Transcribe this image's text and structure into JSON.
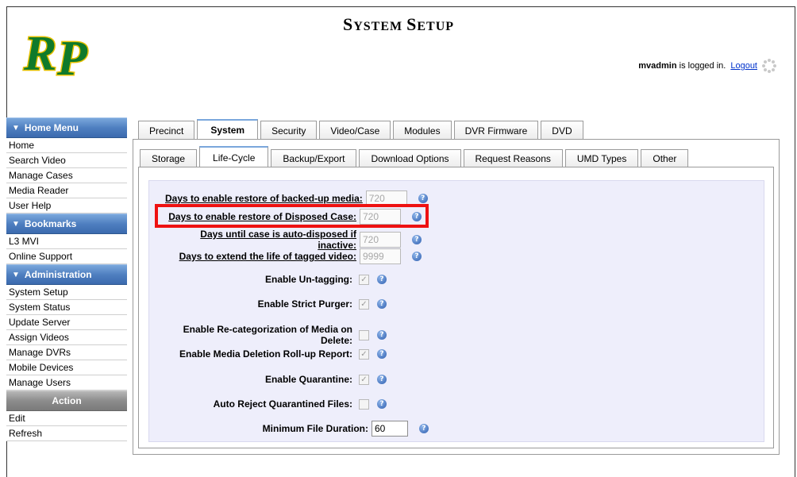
{
  "header": {
    "title_first_letter": "S",
    "title_rest_1": "YSTEM ",
    "title_second_letter": "S",
    "title_rest_2": "ETUP",
    "logo_text": "RP",
    "username": "mvadmin",
    "logged_in_text": " is logged in.",
    "logout_label": "Logout"
  },
  "sidebar": {
    "home_menu": {
      "header": "Home Menu",
      "items": [
        "Home",
        "Search Video",
        "Manage Cases",
        "Media Reader",
        "User Help"
      ]
    },
    "bookmarks": {
      "header": "Bookmarks",
      "items": [
        "L3 MVI",
        "Online Support"
      ]
    },
    "administration": {
      "header": "Administration",
      "items": [
        "System Setup",
        "System Status",
        "Update Server",
        "Assign Videos",
        "Manage DVRs",
        "Mobile Devices",
        "Manage Users"
      ]
    },
    "action": {
      "header": "Action",
      "items": [
        "Edit",
        "Refresh"
      ]
    }
  },
  "main_tabs": [
    "Precinct",
    "System",
    "Security",
    "Video/Case",
    "Modules",
    "DVR Firmware",
    "DVD"
  ],
  "main_tab_selected": "System",
  "sub_tabs": [
    "Storage",
    "Life-Cycle",
    "Backup/Export",
    "Download Options",
    "Request Reasons",
    "UMD Types",
    "Other"
  ],
  "sub_tab_selected": "Life-Cycle",
  "form": {
    "restore_backed_up": {
      "label": "Days to enable restore of backed-up media:",
      "value": "720"
    },
    "restore_disposed": {
      "label": "Days to enable restore of Disposed Case:",
      "value": "720"
    },
    "auto_disposed": {
      "label": "Days until case is auto-disposed if inactive:",
      "value": "720"
    },
    "extend_tagged": {
      "label": "Days to extend the life of tagged video:",
      "value": "9999"
    },
    "untagging": {
      "label": "Enable Un-tagging:",
      "checked": true
    },
    "strict_purger": {
      "label": "Enable Strict Purger:",
      "checked": true
    },
    "recategorization": {
      "label": "Enable Re-categorization of Media on Delete:",
      "checked": false
    },
    "rollup_report": {
      "label": "Enable Media Deletion Roll-up Report:",
      "checked": true
    },
    "quarantine": {
      "label": "Enable Quarantine:",
      "checked": true
    },
    "auto_reject": {
      "label": "Auto Reject Quarantined Files:",
      "checked": false
    },
    "min_duration": {
      "label": "Minimum File Duration:",
      "value": "60"
    }
  },
  "icons": {
    "help": "help-icon",
    "checkmark": "✓",
    "triangle": "▼"
  },
  "colors": {
    "menu_blue": "#4f7fc0",
    "action_gray": "#8c8c8c",
    "form_bg": "#eeeefb",
    "highlight": "#ee1111",
    "logo_green": "#0f7a2b",
    "logo_gold": "#e6c000"
  }
}
